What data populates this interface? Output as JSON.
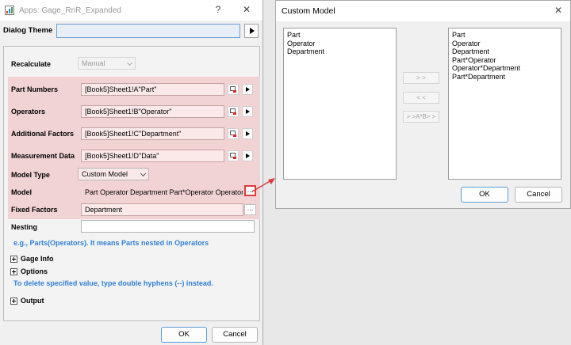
{
  "left_dialog": {
    "title": "Apps: Gage_RnR_Expanded",
    "help_glyph": "?",
    "close_glyph": "✕",
    "dialog_theme_label": "Dialog Theme",
    "dialog_theme_value": "",
    "recalculate": {
      "label": "Recalculate",
      "value": "Manual"
    },
    "part_numbers": {
      "label": "Part Numbers",
      "value": "[Book5]Sheet1!A\"Part\""
    },
    "operators": {
      "label": "Operators",
      "value": "[Book5]Sheet1!B\"Operator\""
    },
    "additional_factors": {
      "label": "Additional Factors",
      "value": "[Book5]Sheet1!C\"Department\""
    },
    "measurement_data": {
      "label": "Measurement Data",
      "value": "[Book5]Sheet1!D\"Data\""
    },
    "model_type": {
      "label": "Model Type",
      "value": "Custom Model"
    },
    "model": {
      "label": "Model",
      "value": "Part Operator Department Part*Operator Operator*Department Part*Department"
    },
    "fixed_factors": {
      "label": "Fixed Factors",
      "value": "Department"
    },
    "nesting": {
      "label": "Nesting",
      "value": ""
    },
    "nesting_hint": "e.g., Parts(Operators). It means Parts nested in Operators",
    "gage_info": "Gage Info",
    "options": "Options",
    "delete_hint": "To delete specified value, type double hyphens (--) instead.",
    "output": "Output",
    "dots_label": "...",
    "ok_label": "OK",
    "cancel_label": "Cancel"
  },
  "right_dialog": {
    "title": "Custom Model",
    "close_glyph": "✕",
    "available_factors": [
      "Part",
      "Operator",
      "Department"
    ],
    "model_terms": [
      "Part",
      "Operator",
      "Department",
      "Part*Operator",
      "Operator*Department",
      "Part*Department"
    ],
    "add_label": "> >",
    "remove_label": "< <",
    "cross_label": "> >A*B> >",
    "ok_label": "OK",
    "cancel_label": "Cancel"
  },
  "colors": {
    "highlight_band": "#f2d3d3",
    "hint_text": "#2f7fd8",
    "callout_arrow": "#e03a3a"
  }
}
